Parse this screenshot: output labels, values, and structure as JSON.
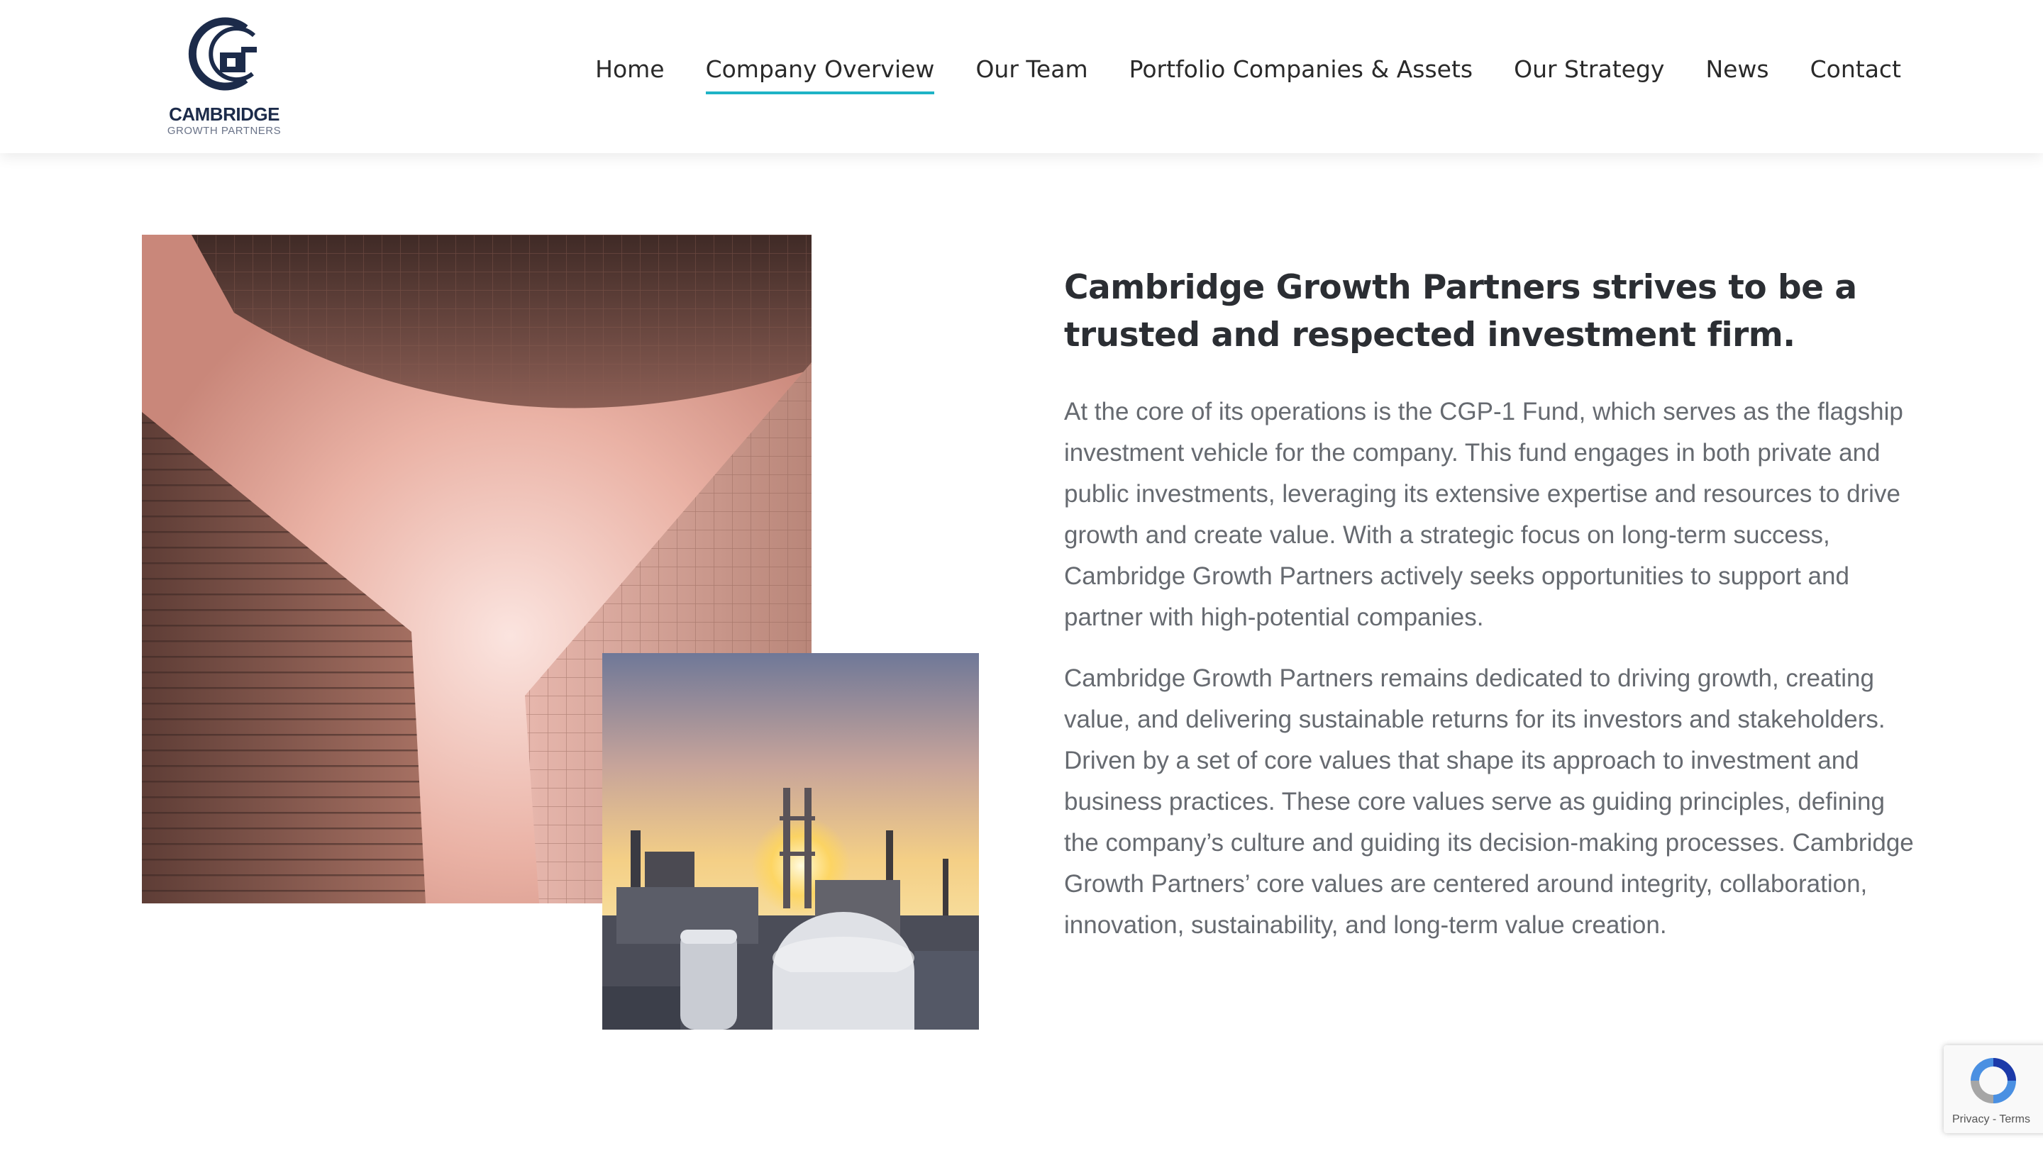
{
  "brand": {
    "name": "CAMBRIDGE",
    "tagline": "GROWTH PARTNERS"
  },
  "nav": {
    "items": [
      {
        "label": "Home"
      },
      {
        "label": "Company Overview"
      },
      {
        "label": "Our Team"
      },
      {
        "label": "Portfolio Companies & Assets"
      },
      {
        "label": "Our Strategy"
      },
      {
        "label": "News"
      },
      {
        "label": "Contact"
      }
    ],
    "active": "Company Overview"
  },
  "main": {
    "heading": "Cambridge Growth Partners strives to be a trusted and respected investment firm.",
    "paragraphs": [
      "At the core of its operations is the CGP-1 Fund, which serves as the flagship investment vehicle for the company. This fund engages in both private and public investments, leveraging its extensive expertise and resources to drive growth and create value. With a strategic focus on long-term success, Cambridge Growth Partners actively seeks opportunities to support and partner with high-potential companies.",
      "Cambridge Growth Partners remains dedicated to driving growth, creating value, and delivering sustainable returns for its investors and stakeholders. Driven by a set of core values that shape its approach to investment and business practices. These core values serve as guiding principles, defining the company’s culture and guiding its decision-making processes. Cambridge Growth Partners’ core values are centered around integrity, collaboration, innovation, sustainability, and long-term value creation."
    ]
  },
  "recaptcha": {
    "links": "Privacy - Terms"
  },
  "colors": {
    "accent": "#1fb3c6",
    "brand_navy": "#1c2b4a",
    "heading": "#2b2e33",
    "body_text": "#666a70"
  },
  "icons": [
    "cambridge-logo-icon",
    "recaptcha-icon"
  ]
}
